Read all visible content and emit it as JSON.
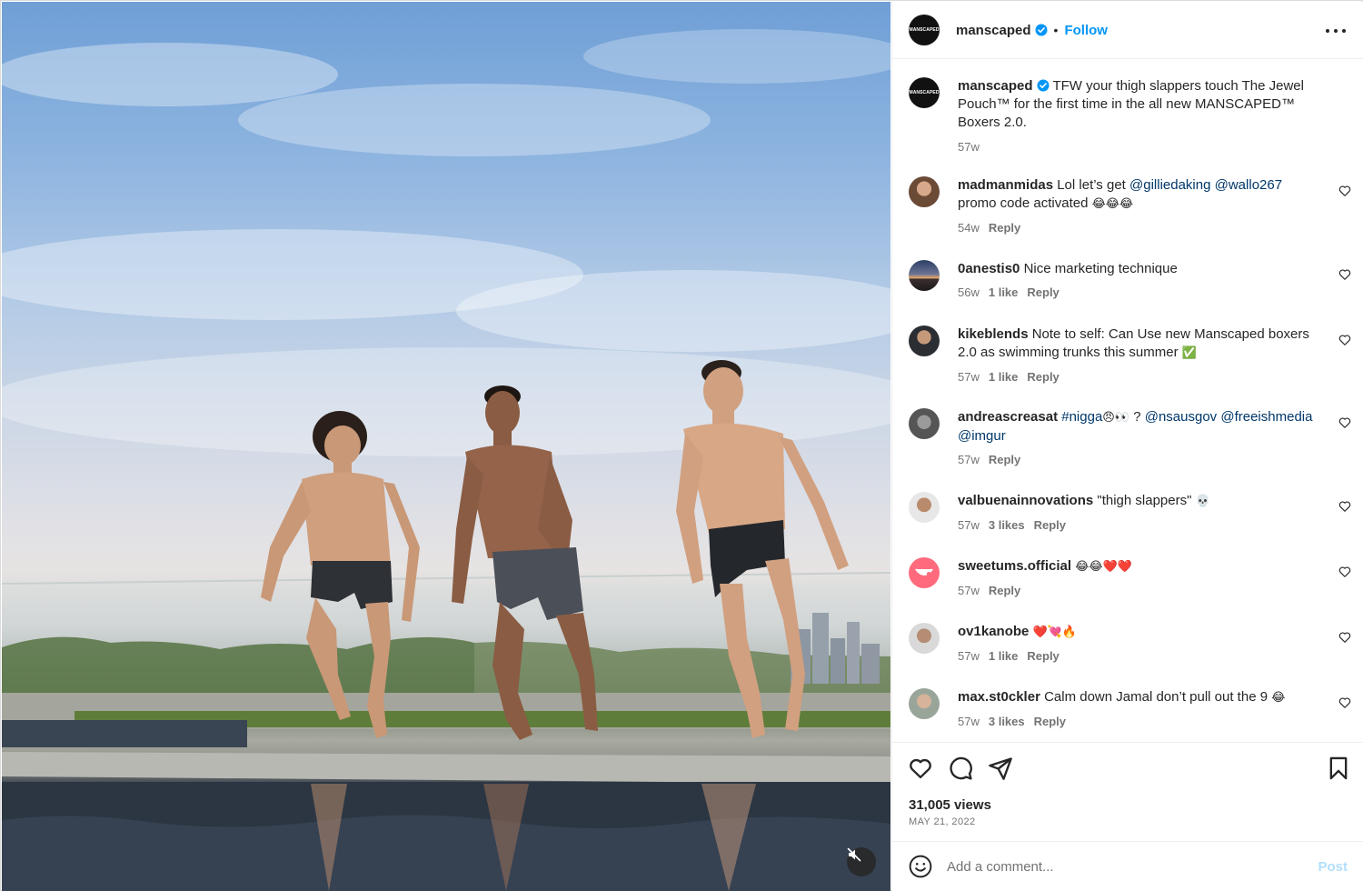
{
  "post": {
    "author": "manscaped",
    "author_avatar_text": "MANSCAPED",
    "follow_label": "Follow",
    "separator": "•",
    "caption": "TFW your thigh slappers touch The Jewel Pouch™ for the first time in the all new MANSCAPED™ Boxers 2.0.",
    "caption_time": "57w",
    "views": "31,005 views",
    "date": "MAY 21, 2022"
  },
  "comments": [
    {
      "user": "madmanmidas",
      "pre": "Lol let’s get ",
      "tags": [
        "@gilliedaking",
        "@wallo267"
      ],
      "post": "promo code activated",
      "emoji": "😂😂😂",
      "time": "54w",
      "likes": "",
      "reply": "Reply"
    },
    {
      "user": "0anestis0",
      "text": "Nice marketing technique",
      "time": "56w",
      "likes": "1 like",
      "reply": "Reply"
    },
    {
      "user": "kikeblends",
      "text": "Note to self: Can Use new Manscaped boxers 2.0 as swimming trunks this summer",
      "emoji": "✅",
      "time": "57w",
      "likes": "1 like",
      "reply": "Reply"
    },
    {
      "user": "andreascreasat",
      "tag1": "#nigga",
      "emoji": "😠👀",
      "mid": " ? ",
      "tag2": "@nsausgov",
      "tag3": "@freeishmedia",
      "tag4": "@imgur",
      "time": "57w",
      "likes": "",
      "reply": "Reply"
    },
    {
      "user": "valbuenainnovations",
      "text": "\"thigh slappers\"",
      "emoji": "💀",
      "time": "57w",
      "likes": "3 likes",
      "reply": "Reply"
    },
    {
      "user": "sweetums.official",
      "text": "",
      "emoji": "😂😂❤️❤️",
      "time": "57w",
      "likes": "",
      "reply": "Reply"
    },
    {
      "user": "ov1kanobe",
      "text": "",
      "emoji": "❤️💘🔥",
      "time": "57w",
      "likes": "1 like",
      "reply": "Reply"
    },
    {
      "user": "max.st0ckler",
      "text": "Calm down Jamal don’t pull out the 9",
      "emoji": "😂",
      "time": "57w",
      "likes": "3 likes",
      "reply": "Reply"
    }
  ],
  "add_comment": {
    "placeholder": "Add a comment...",
    "post_label": "Post"
  },
  "colors": {
    "accent": "#0095f6",
    "tag": "#00376b",
    "muted": "#737373",
    "post_disabled": "#b2dffc"
  },
  "icons": {
    "verified": "verified-badge-icon",
    "like": "heart-icon",
    "comment": "comment-bubble-icon",
    "share": "paper-plane-icon",
    "save": "bookmark-icon",
    "emoji": "smile-icon",
    "mute": "muted-speaker-icon",
    "more": "ellipsis-icon"
  }
}
